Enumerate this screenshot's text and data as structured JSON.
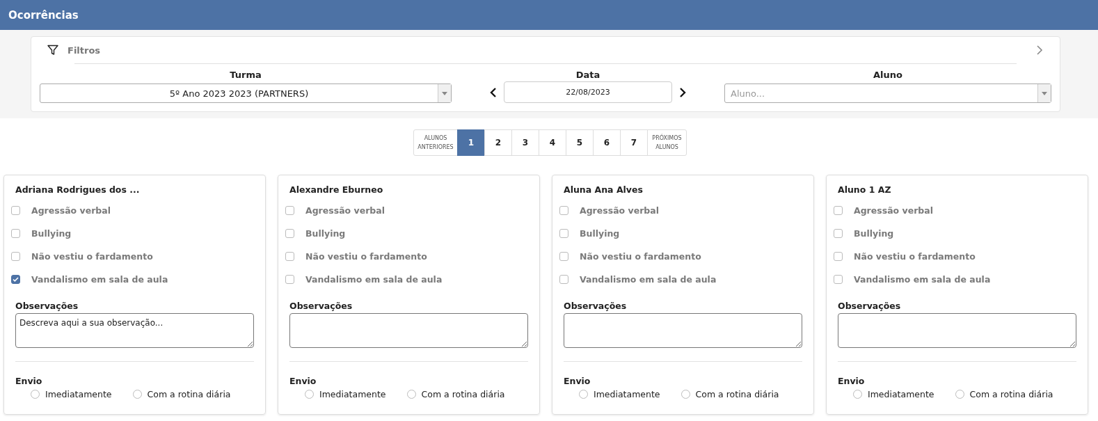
{
  "header": {
    "title": "Ocorrências"
  },
  "filters": {
    "title": "Filtros",
    "turma": {
      "label": "Turma",
      "value": "5º Ano 2023 2023 (PARTNERS)"
    },
    "data": {
      "label": "Data",
      "value": "22/08/2023"
    },
    "aluno": {
      "label": "Aluno",
      "placeholder": "Aluno..."
    }
  },
  "pagination": {
    "previous": [
      "ALUNOS",
      "ANTERIORES"
    ],
    "next": [
      "PRÓXIMOS",
      "ALUNOS"
    ],
    "pages": [
      {
        "label": "1",
        "selected": true
      },
      {
        "label": "2",
        "selected": false
      },
      {
        "label": "3",
        "selected": false
      },
      {
        "label": "4",
        "selected": false
      },
      {
        "label": "5",
        "selected": false
      },
      {
        "label": "6",
        "selected": false
      },
      {
        "label": "7",
        "selected": false
      }
    ]
  },
  "students": [
    {
      "name": "Adriana Rodrigues dos ...",
      "occurrences": [
        {
          "label": "Agressão verbal",
          "checked": false
        },
        {
          "label": "Bullying",
          "checked": false
        },
        {
          "label": "Não vestiu o fardamento",
          "checked": false
        },
        {
          "label": "Vandalismo em sala de aula",
          "checked": true
        }
      ],
      "notes_label": "Observações",
      "notes": "Descreva aqui a sua observação...",
      "send_label": "Envio",
      "send_options": [
        {
          "label": "Imediatamente",
          "selected": false
        },
        {
          "label": "Com a rotina diária",
          "selected": false
        }
      ]
    },
    {
      "name": "Alexandre Eburneo",
      "occurrences": [
        {
          "label": "Agressão verbal",
          "checked": false
        },
        {
          "label": "Bullying",
          "checked": false
        },
        {
          "label": "Não vestiu o fardamento",
          "checked": false
        },
        {
          "label": "Vandalismo em sala de aula",
          "checked": false
        }
      ],
      "notes_label": "Observações",
      "send_label": "Envio",
      "send_options": [
        {
          "label": "Imediatamente",
          "selected": false
        },
        {
          "label": "Com a rotina diária",
          "selected": false
        }
      ]
    },
    {
      "name": "Aluna Ana Alves",
      "occurrences": [
        {
          "label": "Agressão verbal",
          "checked": false
        },
        {
          "label": "Bullying",
          "checked": false
        },
        {
          "label": "Não vestiu o fardamento",
          "checked": false
        },
        {
          "label": "Vandalismo em sala de aula",
          "checked": false
        }
      ],
      "notes_label": "Observações",
      "send_label": "Envio",
      "send_options": [
        {
          "label": "Imediatamente",
          "selected": false
        },
        {
          "label": "Com a rotina diária",
          "selected": false
        }
      ]
    },
    {
      "name": "Aluno 1 AZ",
      "occurrences": [
        {
          "label": "Agressão verbal",
          "checked": false
        },
        {
          "label": "Bullying",
          "checked": false
        },
        {
          "label": "Não vestiu o fardamento",
          "checked": false
        },
        {
          "label": "Vandalismo em sala de aula",
          "checked": false
        }
      ],
      "notes_label": "Observações",
      "send_label": "Envio",
      "send_options": [
        {
          "label": "Imediatamente",
          "selected": false
        },
        {
          "label": "Com a rotina diária",
          "selected": false
        }
      ]
    }
  ]
}
